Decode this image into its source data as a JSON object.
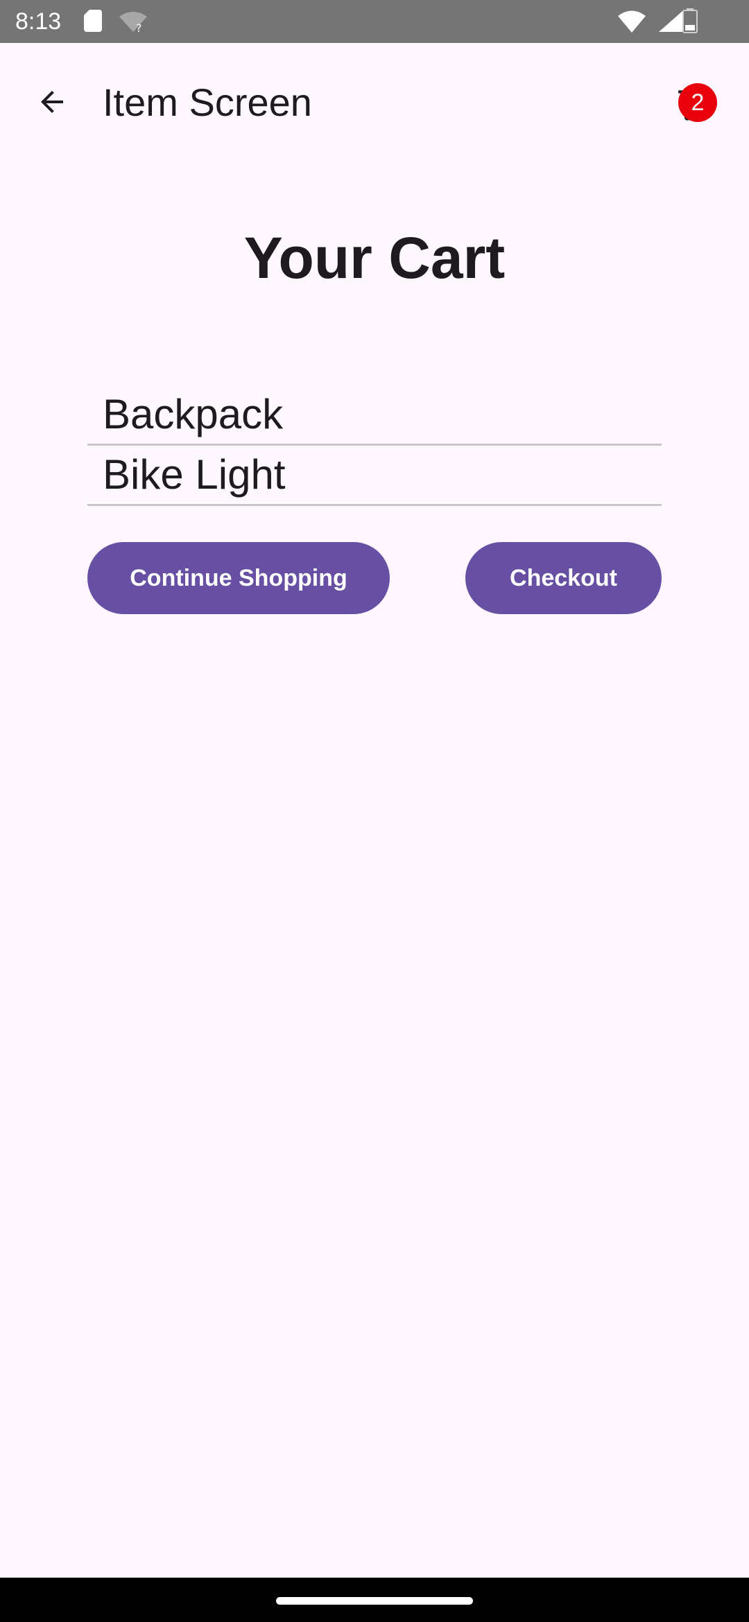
{
  "status_bar": {
    "time": "8:13",
    "icons": [
      "sd-card-icon",
      "wifi-question-icon",
      "wifi-icon",
      "signal-icon",
      "battery-icon"
    ]
  },
  "app_bar": {
    "title": "Item Screen",
    "back_icon": "arrow-back-icon",
    "cart_icon": "shopping-cart-icon",
    "cart_badge_count": "2"
  },
  "main": {
    "title": "Your Cart",
    "items": [
      {
        "label": "Backpack"
      },
      {
        "label": "Bike Light"
      }
    ],
    "continue_label": "Continue Shopping",
    "checkout_label": "Checkout"
  },
  "colors": {
    "background": "#FEF7FF",
    "primary": "#6750A4",
    "badge": "#E8000B",
    "status_bar": "#757575"
  }
}
